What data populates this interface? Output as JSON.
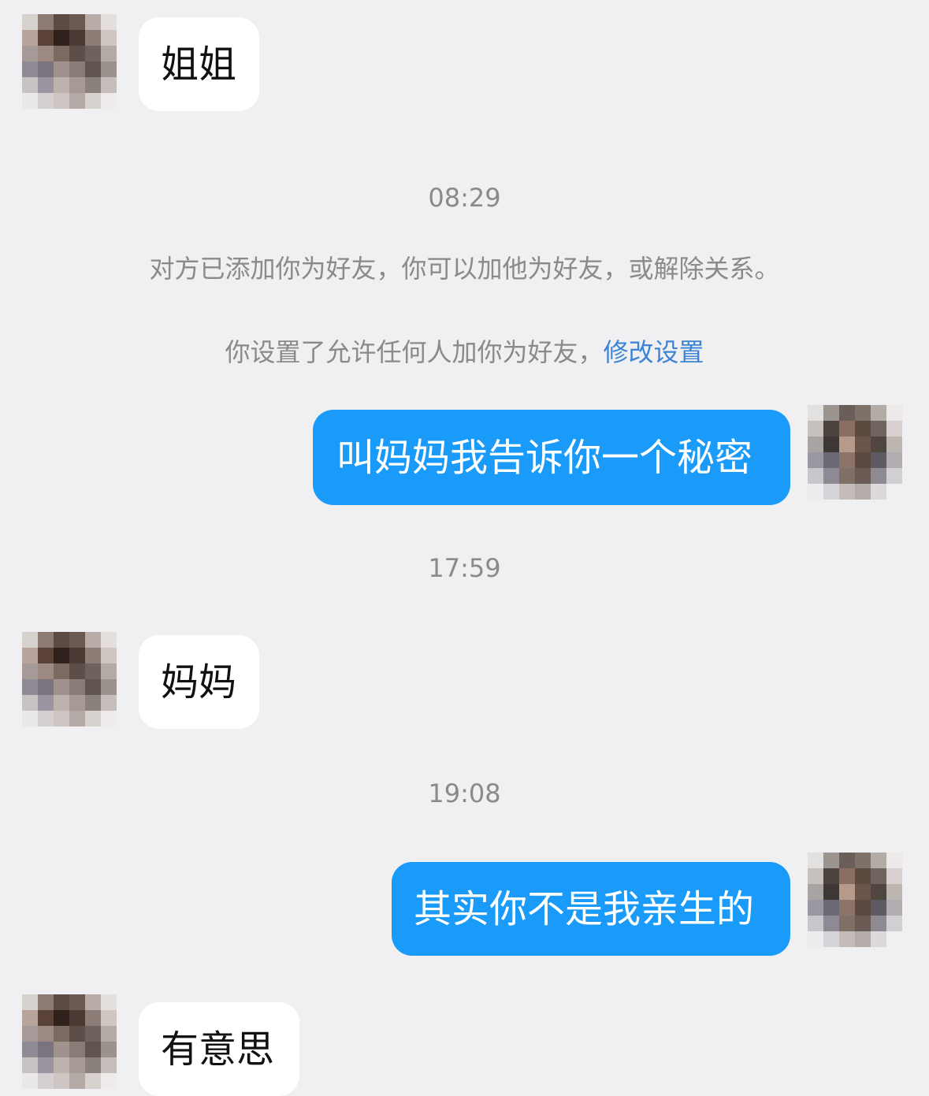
{
  "messages": [
    {
      "type": "incoming",
      "text": "姐姐"
    },
    {
      "type": "time",
      "text": "08:29"
    },
    {
      "type": "notice",
      "text": "对方已添加你为好友，你可以加他为好友，或解除关系。"
    },
    {
      "type": "notice",
      "text": "你设置了允许任何人加你为好友，",
      "link": "修改设置"
    },
    {
      "type": "outgoing",
      "text": "叫妈妈我告诉你一个秘密"
    },
    {
      "type": "time",
      "text": "17:59"
    },
    {
      "type": "incoming",
      "text": "妈妈"
    },
    {
      "type": "time",
      "text": "19:08"
    },
    {
      "type": "outgoing",
      "text": "其实你不是我亲生的"
    },
    {
      "type": "incoming",
      "text": "有意思"
    }
  ],
  "colors": {
    "background": "#f0f0f2",
    "outgoing_bubble": "#1a9bfa",
    "incoming_bubble": "#ffffff",
    "link": "#3b84d6",
    "system_text": "#8a8a8a"
  },
  "avatars": {
    "contact": "blurred-avatar",
    "self": "blurred-avatar"
  }
}
